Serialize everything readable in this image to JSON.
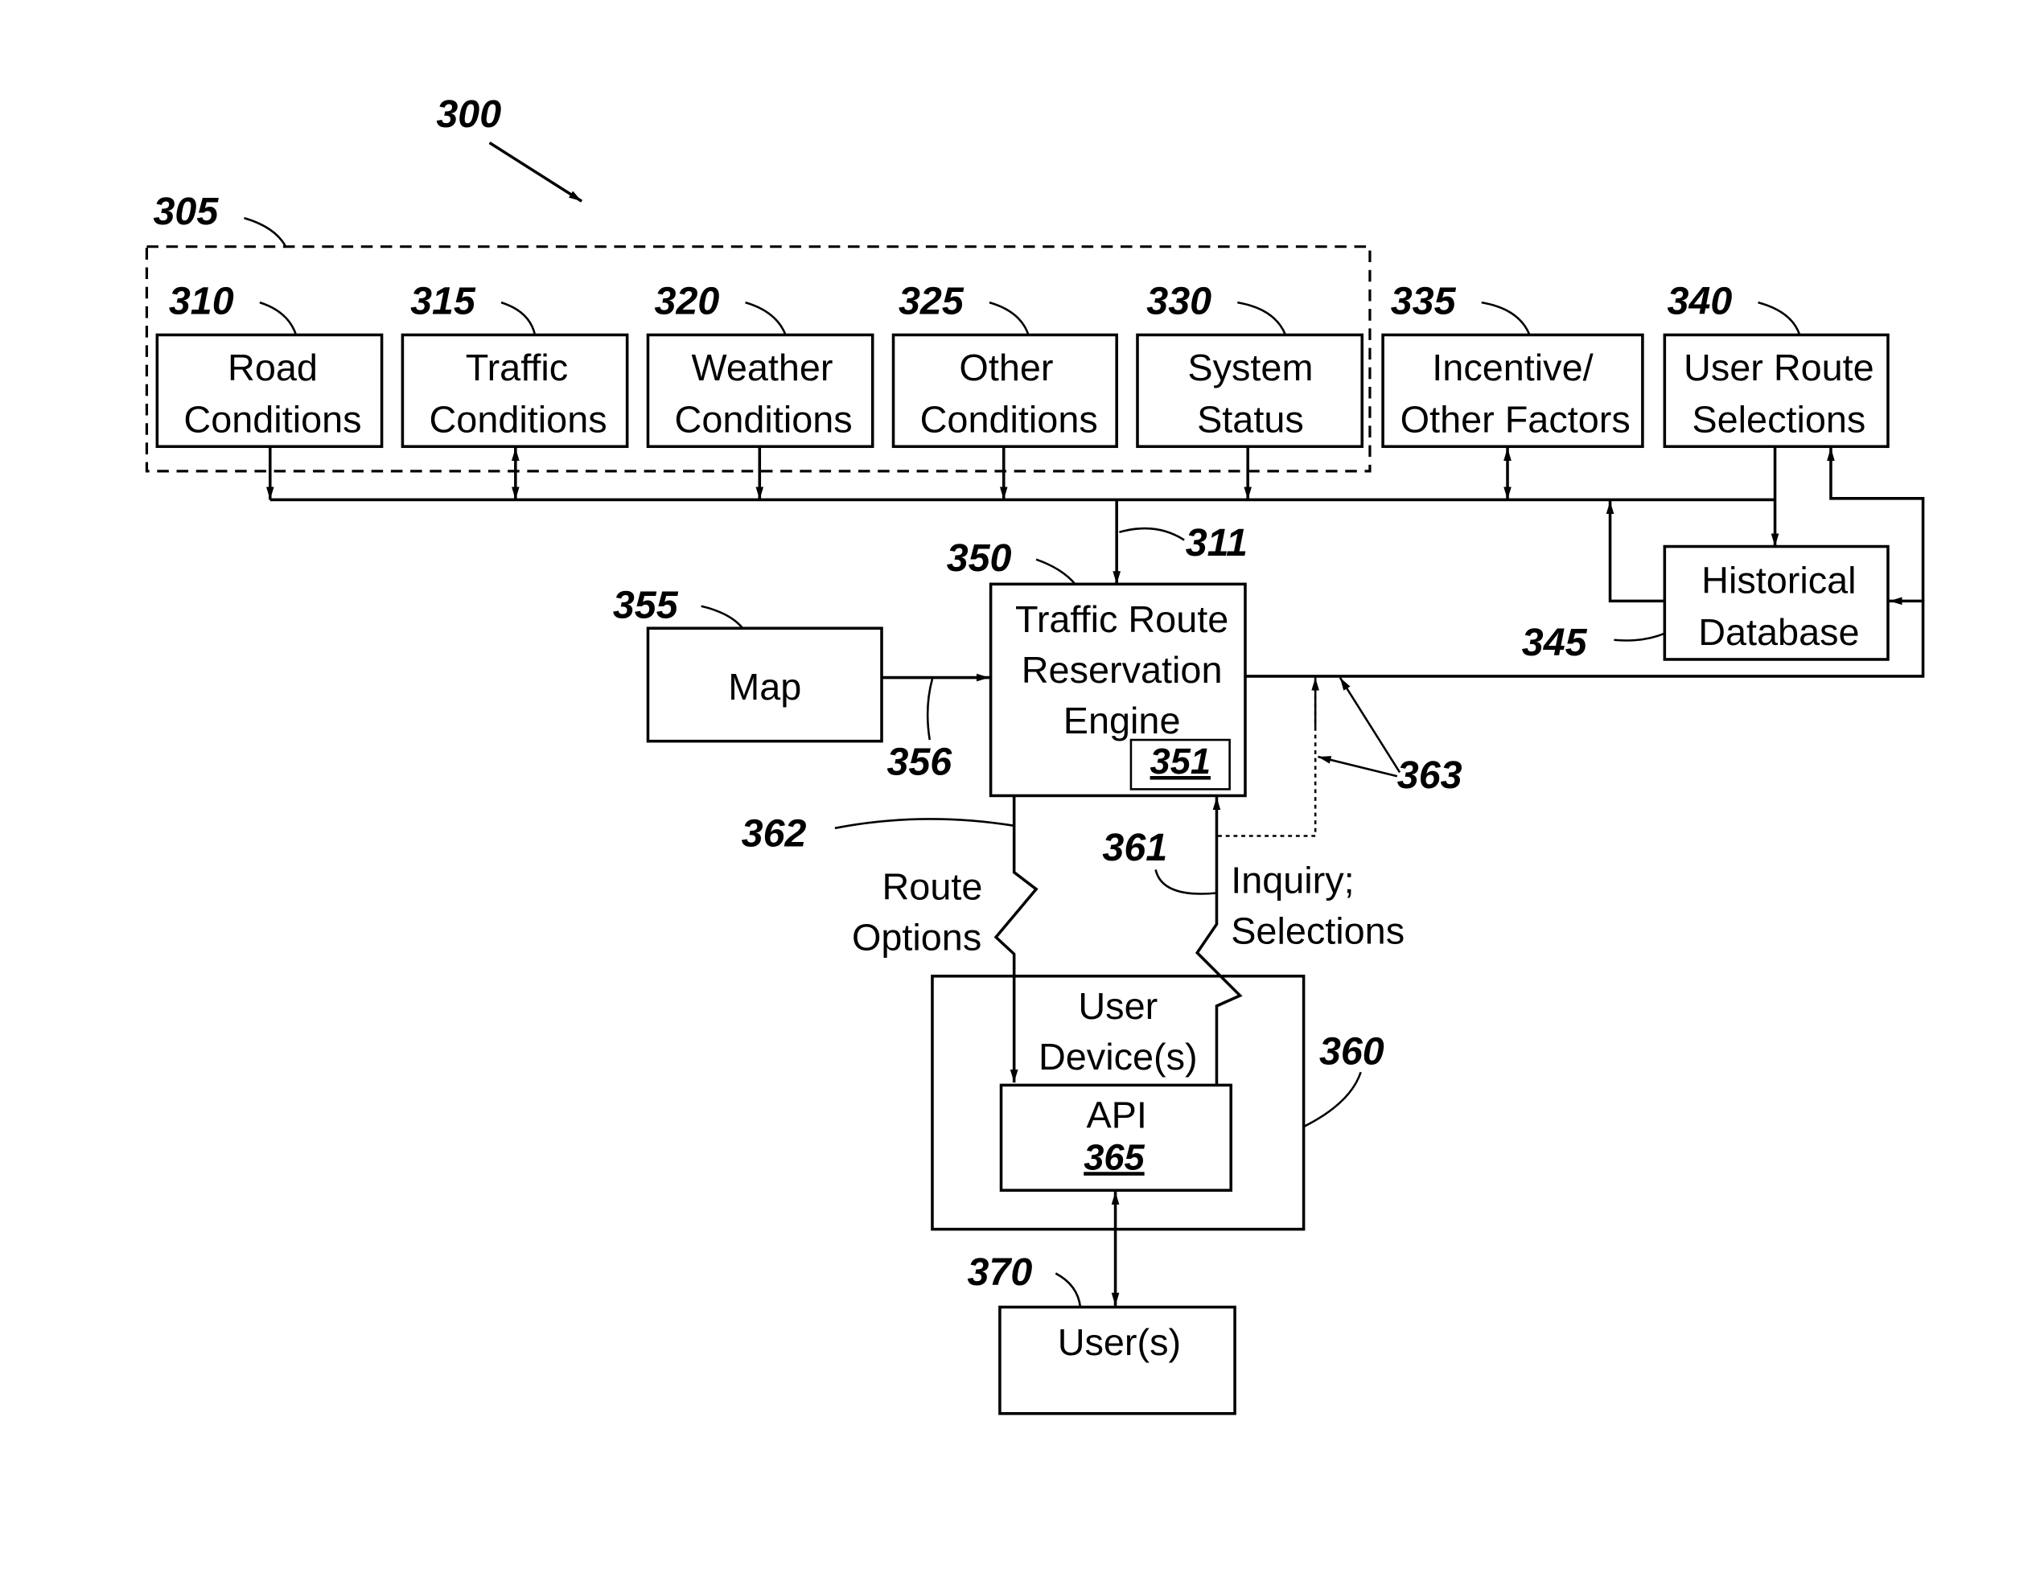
{
  "figure": {
    "ref": "300",
    "group_ref": "305",
    "inputs": [
      {
        "ref": "310",
        "line1": "Road",
        "line2": "Conditions"
      },
      {
        "ref": "315",
        "line1": "Traffic",
        "line2": "Conditions"
      },
      {
        "ref": "320",
        "line1": "Weather",
        "line2": "Conditions"
      },
      {
        "ref": "325",
        "line1": "Other",
        "line2": "Conditions"
      },
      {
        "ref": "330",
        "line1": "System",
        "line2": "Status"
      },
      {
        "ref": "335",
        "line1": "Incentive/",
        "line2": "Other Factors"
      },
      {
        "ref": "340",
        "line1": "User Route",
        "line2": "Selections"
      }
    ],
    "bus_ref": "311",
    "engine": {
      "ref": "350",
      "line1": "Traffic Route",
      "line2": "Reservation",
      "line3": "Engine",
      "sub_ref": "351"
    },
    "map": {
      "ref": "355",
      "label": "Map",
      "link_ref": "356"
    },
    "historical": {
      "ref": "345",
      "line1": "Historical",
      "line2": "Database"
    },
    "feedback_ref": "363",
    "route_options": {
      "ref": "362",
      "line1": "Route",
      "line2": "Options"
    },
    "inquiry": {
      "ref": "361",
      "line1": "Inquiry;",
      "line2": "Selections"
    },
    "device": {
      "ref": "360",
      "line1": "User",
      "line2": "Device(s)"
    },
    "api": {
      "label": "API",
      "ref": "365"
    },
    "users": {
      "ref": "370",
      "label": "User(s)"
    }
  }
}
